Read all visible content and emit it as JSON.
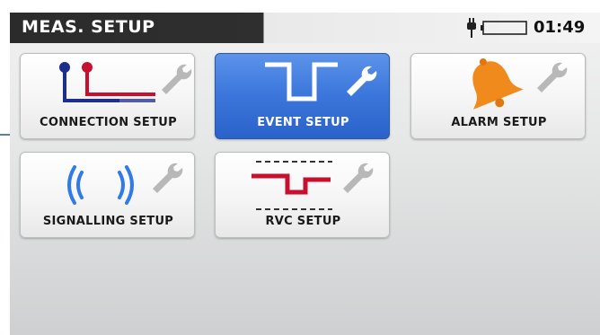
{
  "header": {
    "title": "MEAS. SETUP",
    "clock": "01:49",
    "icons": {
      "plug": "power-plug-icon",
      "battery": "battery-icon"
    }
  },
  "menu": {
    "selected_index": 1,
    "tiles": [
      {
        "label": "CONNECTION SETUP",
        "icon": "connection-wires-icon",
        "tool_icon": "wrench-icon"
      },
      {
        "label": "EVENT SETUP",
        "icon": "voltage-dip-icon",
        "tool_icon": "wrench-icon"
      },
      {
        "label": "ALARM SETUP",
        "icon": "bell-icon",
        "tool_icon": "wrench-icon"
      },
      {
        "label": "SIGNALLING SETUP",
        "icon": "signal-waves-icon",
        "tool_icon": "wrench-icon"
      },
      {
        "label": "RVC SETUP",
        "icon": "rapid-voltage-change-icon",
        "tool_icon": "wrench-icon"
      }
    ]
  },
  "colors": {
    "header_dark": "#2b2b2b",
    "tile_selected": "#3d78dc",
    "wire_blue": "#1d2f8c",
    "wire_red": "#c8102e",
    "bell_orange": "#f08a1c",
    "signal_blue": "#2f7be8",
    "wrench_gray": "#b8b8b8"
  }
}
